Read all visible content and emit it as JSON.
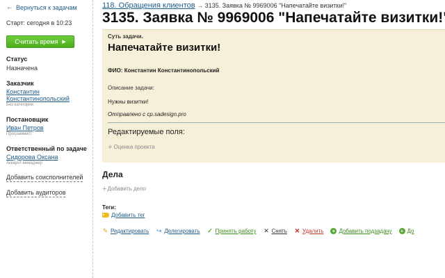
{
  "sidebar": {
    "back_label": "Вернуться к задачам",
    "start_label": "Старт: сегодня в 10:23",
    "timer_button": "Считать время",
    "status": {
      "heading": "Статус",
      "value": "Назначена"
    },
    "customer": {
      "heading": "Заказчик",
      "name_line1": "Константин",
      "name_line2": "Константинопольский",
      "sub": "Без категории"
    },
    "creator": {
      "heading": "Постановщик",
      "name": "Иван Петров",
      "sub": "Программист"
    },
    "responsible": {
      "heading": "Ответственный по задаче",
      "name": "Сидорова Оксана",
      "sub": "Аккаунт-менеджер"
    },
    "add_coexecutors": "Добавить соисполнителей",
    "add_auditors": "Добавить аудиторов"
  },
  "breadcrumb": {
    "parent": "118. Обращения клиентов",
    "separator": "→",
    "current": "3135. Заявка № 9969006 \"Напечатайте визитки!\""
  },
  "task": {
    "title": "3135. Заявка № 9969006 \"Напечатайте визитки!\"",
    "essence_label": "Суть задачи.",
    "essence_title": "Напечатайте визитки!",
    "fio": "ФИО: Константин Константинопольский",
    "description_label": "Описание задачи:",
    "description_text": "Нужны визитки!",
    "sent_from": "Отправлено с cp.sadesign.pro",
    "editable_fields": "Редактируемые поля:",
    "project_rating": "Оценка проекта"
  },
  "cases": {
    "title": "Дела",
    "add": "Добавить дело"
  },
  "tags": {
    "title": "Теги:",
    "add": "Добавить тег"
  },
  "actions": {
    "edit": "Редактировать",
    "delegate": "Делегировать",
    "accept": "Принять работу",
    "remove": "Снять",
    "delete": "Удалить",
    "add_subtask": "Добавить подзадачу",
    "more": "До"
  }
}
